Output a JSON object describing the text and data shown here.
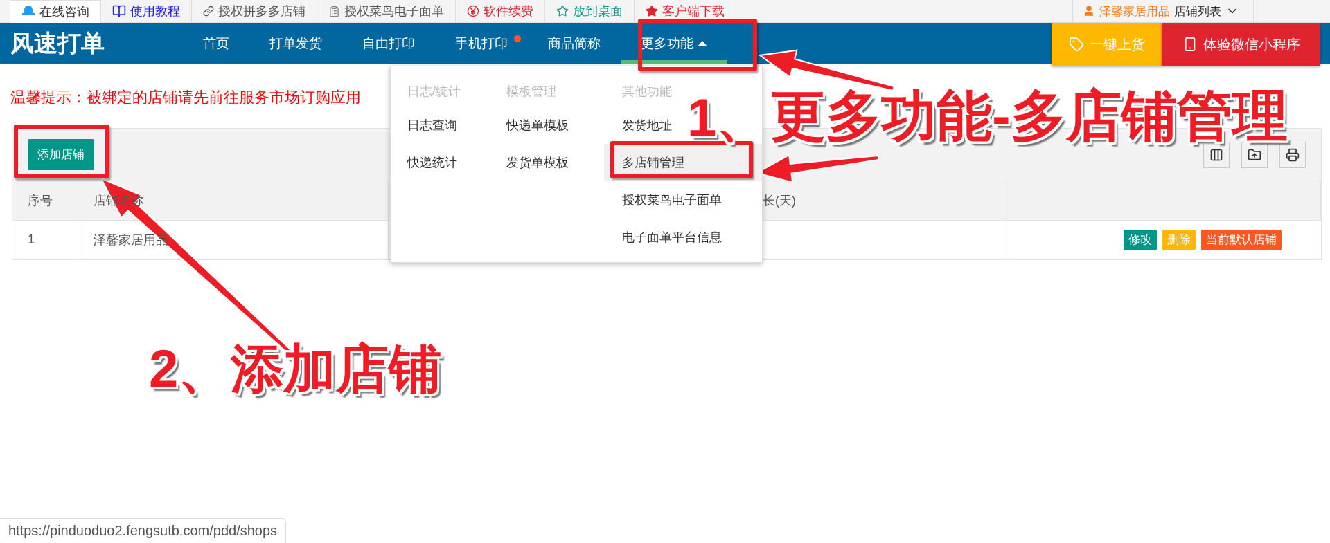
{
  "top_links": [
    {
      "label": "在线咨询",
      "kind": "chat",
      "selected": true,
      "color": "#333333"
    },
    {
      "label": "使用教程",
      "kind": "book",
      "selected": false,
      "color": "#2222ee"
    },
    {
      "label": "授权拼多多店铺",
      "kind": "link",
      "selected": false,
      "color": "#555555"
    },
    {
      "label": "授权菜鸟电子面单",
      "kind": "clipboard",
      "selected": false,
      "color": "#555555"
    },
    {
      "label": "软件续费",
      "kind": "yen",
      "selected": false,
      "color": "#e0242f"
    },
    {
      "label": "放到桌面",
      "kind": "star-outline",
      "selected": false,
      "color": "#139b8a"
    },
    {
      "label": "客户端下载",
      "kind": "star",
      "selected": false,
      "color": "#e0242f"
    }
  ],
  "account": {
    "shop": "泽馨家居用品",
    "menu": "店铺列表"
  },
  "logo": "风速打单",
  "nav": [
    {
      "label": "首页",
      "selected": false,
      "badge": false
    },
    {
      "label": "打单发货",
      "selected": false,
      "badge": false
    },
    {
      "label": "自由打印",
      "selected": false,
      "badge": false
    },
    {
      "label": "手机打印",
      "selected": false,
      "badge": true
    },
    {
      "label": "商品简称",
      "selected": false,
      "badge": false
    },
    {
      "label": "更多功能",
      "selected": true,
      "badge": false,
      "expanded": true
    }
  ],
  "action_buttons": [
    {
      "label": "一键上货",
      "kind": "tag"
    },
    {
      "label": "体验微信小程序",
      "kind": "phone"
    }
  ],
  "notice": "温馨提示：被绑定的店铺请先前往服务市场订购应用",
  "add_button": "添加店铺",
  "table": {
    "columns": [
      "序号",
      "店铺名称",
      "长(天)"
    ],
    "rows": [
      {
        "cells": [
          "1",
          "泽馨家居用品"
        ],
        "actions": [
          {
            "label": "修改",
            "color": "#009688"
          },
          {
            "label": "删除",
            "color": "#ffb800"
          },
          {
            "label": "当前默认店铺",
            "color": "#ff5722"
          }
        ]
      }
    ]
  },
  "dropdown": {
    "columns": [
      {
        "header": "日志/统计",
        "items": [
          {
            "label": "日志查询",
            "selected": false
          },
          {
            "label": "快递统计",
            "selected": false
          }
        ]
      },
      {
        "header": "模板管理",
        "items": [
          {
            "label": "快递单模板",
            "selected": false
          },
          {
            "label": "发货单模板",
            "selected": false
          }
        ]
      },
      {
        "header": "其他功能",
        "items": [
          {
            "label": "发货地址",
            "selected": false
          },
          {
            "label": "多店铺管理",
            "selected": true
          },
          {
            "label": "授权菜鸟电子面单",
            "selected": false
          },
          {
            "label": "电子面单平台信息",
            "selected": false
          }
        ]
      }
    ]
  },
  "status_url": "https://pinduoduo2.fengsutb.com/pdd/shops",
  "annotations": [
    {
      "text": "1、"
    },
    {
      "text": "更多功能-多店铺管理"
    },
    {
      "text": "2、添加店铺"
    }
  ]
}
